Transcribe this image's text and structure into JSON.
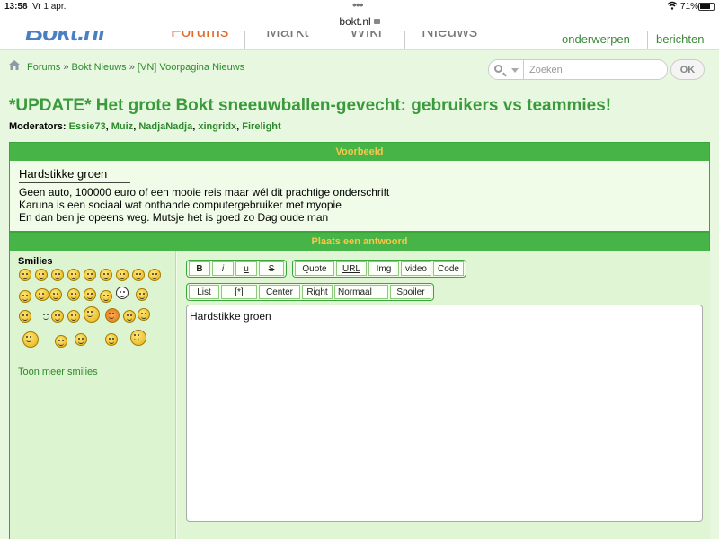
{
  "status_bar": {
    "time": "13:58",
    "date": "Vr 1 apr.",
    "battery": "71%"
  },
  "browser": {
    "url": "bokt.nl"
  },
  "site": {
    "logo": "Bokt.nl",
    "nav": [
      "Forums",
      "Markt",
      "Wiki",
      "Nieuws"
    ],
    "nav_active": "Forums",
    "nav_right": [
      "onderwerpen",
      "berichten"
    ]
  },
  "breadcrumb": {
    "items": [
      "Forums",
      "Bokt Nieuws"
    ],
    "current": "[VN] Voorpagina Nieuws",
    "separator": "»"
  },
  "search": {
    "placeholder": "Zoeken",
    "button": "OK"
  },
  "thread": {
    "title": "*UPDATE* Het grote Bokt sneeuwballen-gevecht: gebruikers vs teammies!",
    "moderators_label": "Moderators:",
    "moderators": [
      "Essie73",
      "Muiz",
      "NadjaNadja",
      "xingridx",
      "Firelight"
    ]
  },
  "preview": {
    "header": "Voorbeeld",
    "text": "Hardstikke groen",
    "signature": [
      "Geen auto, 100000 euro of een mooie reis maar wél dit prachtige onderschrift",
      "Karuna is een sociaal wat onthande computergebruiker met myopie",
      "En dan ben je opeens weg. Mutsje het is goed zo Dag oude man"
    ]
  },
  "reply": {
    "header": "Plaats een antwoord",
    "smilies_title": "Smilies",
    "more_smilies": "Toon meer smilies",
    "message": "Hardstikke groen",
    "toolbar_row1": {
      "group1": [
        "B",
        "i",
        "u",
        "S"
      ],
      "group2": [
        "Quote",
        "URL",
        "Img",
        "video",
        "Code"
      ]
    },
    "toolbar_row2": {
      "buttons": [
        "List",
        "[*]",
        "Center",
        "Right"
      ],
      "size_select": "Normaal",
      "spoiler": "Spoiler"
    }
  },
  "colors": {
    "accent_green": "#46b446",
    "title_green": "#3b9a3b",
    "panel_header_text": "#f7c84a",
    "active_nav": "#e06a2a"
  }
}
